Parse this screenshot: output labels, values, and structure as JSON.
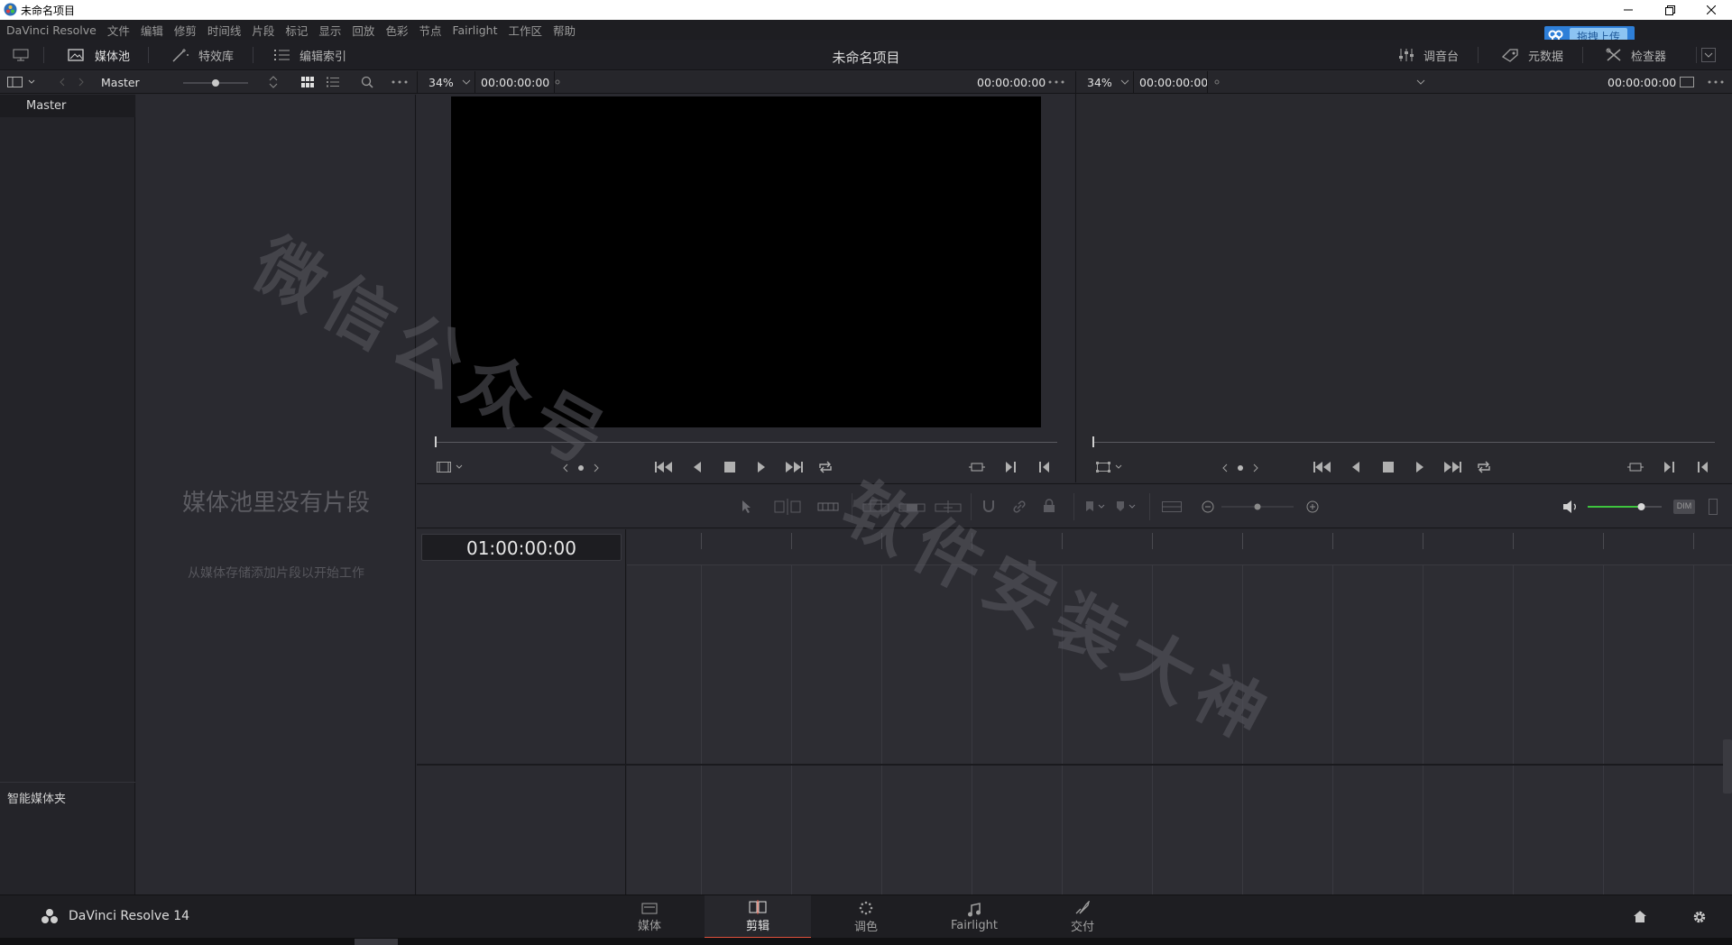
{
  "window": {
    "title": "未命名项目"
  },
  "menu": [
    "DaVinci Resolve",
    "文件",
    "编辑",
    "修剪",
    "时间线",
    "片段",
    "标记",
    "显示",
    "回放",
    "色彩",
    "节点",
    "Fairlight",
    "工作区",
    "帮助"
  ],
  "upload_badge": {
    "label": "拖拽上传"
  },
  "toolbar": {
    "media_pool": "媒体池",
    "effects": "特效库",
    "edit_index": "编辑索引",
    "project_title": "未命名项目",
    "mixer": "调音台",
    "metadata": "元数据",
    "inspector": "检查器"
  },
  "bins": {
    "path": "Master",
    "master": "Master",
    "smart_bins": "智能媒体夹"
  },
  "media_pool": {
    "empty_title": "媒体池里没有片段",
    "empty_sub": "从媒体存储添加片段以开始工作"
  },
  "source_viewer": {
    "zoom": "34%",
    "timecode_left": "00:00:00:00",
    "timecode_right": "00:00:00:00"
  },
  "record_viewer": {
    "zoom": "34%",
    "timecode_left": "00:00:00:00",
    "timecode_right": "00:00:00:00"
  },
  "timeline": {
    "timecode": "01:00:00:00",
    "dim_label": "DIM",
    "volume_level": 0.75
  },
  "pages": [
    {
      "label": "媒体",
      "icon": "media-page-icon"
    },
    {
      "label": "剪辑",
      "icon": "edit-page-icon",
      "active": true
    },
    {
      "label": "调色",
      "icon": "color-page-icon"
    },
    {
      "label": "Fairlight",
      "icon": "fairlight-page-icon"
    },
    {
      "label": "交付",
      "icon": "deliver-page-icon"
    }
  ],
  "brand": "DaVinci Resolve 14",
  "watermark": {
    "line1": "微信公众号",
    "line2": "软件安装大神"
  },
  "colors": {
    "accent": "#e0503c",
    "badge": "#2e7fd8",
    "volume": "#3ec43e"
  }
}
